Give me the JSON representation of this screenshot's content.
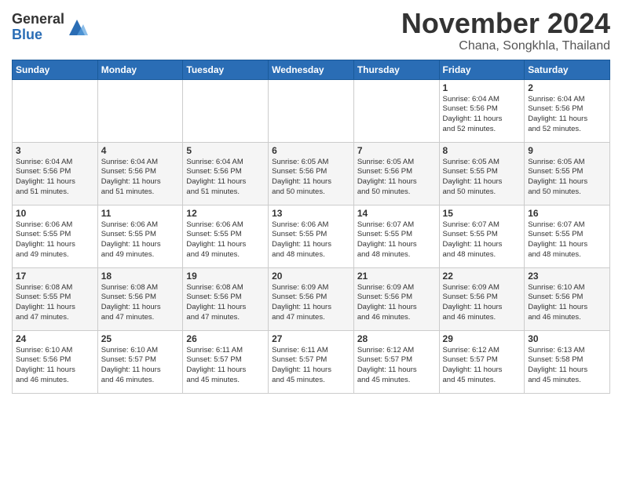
{
  "header": {
    "logo_general": "General",
    "logo_blue": "Blue",
    "title": "November 2024",
    "subtitle": "Chana, Songkhla, Thailand"
  },
  "calendar": {
    "days_of_week": [
      "Sunday",
      "Monday",
      "Tuesday",
      "Wednesday",
      "Thursday",
      "Friday",
      "Saturday"
    ],
    "weeks": [
      [
        {
          "day": "",
          "info": ""
        },
        {
          "day": "",
          "info": ""
        },
        {
          "day": "",
          "info": ""
        },
        {
          "day": "",
          "info": ""
        },
        {
          "day": "",
          "info": ""
        },
        {
          "day": "1",
          "info": "Sunrise: 6:04 AM\nSunset: 5:56 PM\nDaylight: 11 hours\nand 52 minutes."
        },
        {
          "day": "2",
          "info": "Sunrise: 6:04 AM\nSunset: 5:56 PM\nDaylight: 11 hours\nand 52 minutes."
        }
      ],
      [
        {
          "day": "3",
          "info": "Sunrise: 6:04 AM\nSunset: 5:56 PM\nDaylight: 11 hours\nand 51 minutes."
        },
        {
          "day": "4",
          "info": "Sunrise: 6:04 AM\nSunset: 5:56 PM\nDaylight: 11 hours\nand 51 minutes."
        },
        {
          "day": "5",
          "info": "Sunrise: 6:04 AM\nSunset: 5:56 PM\nDaylight: 11 hours\nand 51 minutes."
        },
        {
          "day": "6",
          "info": "Sunrise: 6:05 AM\nSunset: 5:56 PM\nDaylight: 11 hours\nand 50 minutes."
        },
        {
          "day": "7",
          "info": "Sunrise: 6:05 AM\nSunset: 5:56 PM\nDaylight: 11 hours\nand 50 minutes."
        },
        {
          "day": "8",
          "info": "Sunrise: 6:05 AM\nSunset: 5:55 PM\nDaylight: 11 hours\nand 50 minutes."
        },
        {
          "day": "9",
          "info": "Sunrise: 6:05 AM\nSunset: 5:55 PM\nDaylight: 11 hours\nand 50 minutes."
        }
      ],
      [
        {
          "day": "10",
          "info": "Sunrise: 6:06 AM\nSunset: 5:55 PM\nDaylight: 11 hours\nand 49 minutes."
        },
        {
          "day": "11",
          "info": "Sunrise: 6:06 AM\nSunset: 5:55 PM\nDaylight: 11 hours\nand 49 minutes."
        },
        {
          "day": "12",
          "info": "Sunrise: 6:06 AM\nSunset: 5:55 PM\nDaylight: 11 hours\nand 49 minutes."
        },
        {
          "day": "13",
          "info": "Sunrise: 6:06 AM\nSunset: 5:55 PM\nDaylight: 11 hours\nand 48 minutes."
        },
        {
          "day": "14",
          "info": "Sunrise: 6:07 AM\nSunset: 5:55 PM\nDaylight: 11 hours\nand 48 minutes."
        },
        {
          "day": "15",
          "info": "Sunrise: 6:07 AM\nSunset: 5:55 PM\nDaylight: 11 hours\nand 48 minutes."
        },
        {
          "day": "16",
          "info": "Sunrise: 6:07 AM\nSunset: 5:55 PM\nDaylight: 11 hours\nand 48 minutes."
        }
      ],
      [
        {
          "day": "17",
          "info": "Sunrise: 6:08 AM\nSunset: 5:55 PM\nDaylight: 11 hours\nand 47 minutes."
        },
        {
          "day": "18",
          "info": "Sunrise: 6:08 AM\nSunset: 5:56 PM\nDaylight: 11 hours\nand 47 minutes."
        },
        {
          "day": "19",
          "info": "Sunrise: 6:08 AM\nSunset: 5:56 PM\nDaylight: 11 hours\nand 47 minutes."
        },
        {
          "day": "20",
          "info": "Sunrise: 6:09 AM\nSunset: 5:56 PM\nDaylight: 11 hours\nand 47 minutes."
        },
        {
          "day": "21",
          "info": "Sunrise: 6:09 AM\nSunset: 5:56 PM\nDaylight: 11 hours\nand 46 minutes."
        },
        {
          "day": "22",
          "info": "Sunrise: 6:09 AM\nSunset: 5:56 PM\nDaylight: 11 hours\nand 46 minutes."
        },
        {
          "day": "23",
          "info": "Sunrise: 6:10 AM\nSunset: 5:56 PM\nDaylight: 11 hours\nand 46 minutes."
        }
      ],
      [
        {
          "day": "24",
          "info": "Sunrise: 6:10 AM\nSunset: 5:56 PM\nDaylight: 11 hours\nand 46 minutes."
        },
        {
          "day": "25",
          "info": "Sunrise: 6:10 AM\nSunset: 5:57 PM\nDaylight: 11 hours\nand 46 minutes."
        },
        {
          "day": "26",
          "info": "Sunrise: 6:11 AM\nSunset: 5:57 PM\nDaylight: 11 hours\nand 45 minutes."
        },
        {
          "day": "27",
          "info": "Sunrise: 6:11 AM\nSunset: 5:57 PM\nDaylight: 11 hours\nand 45 minutes."
        },
        {
          "day": "28",
          "info": "Sunrise: 6:12 AM\nSunset: 5:57 PM\nDaylight: 11 hours\nand 45 minutes."
        },
        {
          "day": "29",
          "info": "Sunrise: 6:12 AM\nSunset: 5:57 PM\nDaylight: 11 hours\nand 45 minutes."
        },
        {
          "day": "30",
          "info": "Sunrise: 6:13 AM\nSunset: 5:58 PM\nDaylight: 11 hours\nand 45 minutes."
        }
      ]
    ]
  }
}
